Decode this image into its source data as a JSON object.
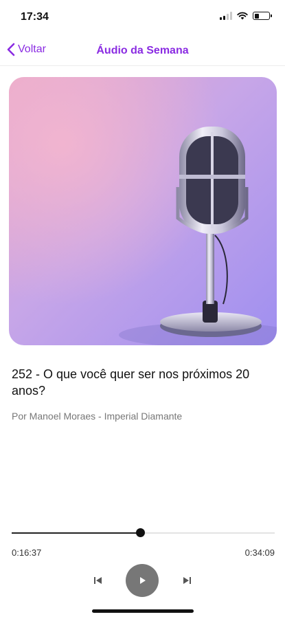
{
  "status_bar": {
    "time": "17:34",
    "battery_level": 0.3
  },
  "nav": {
    "back_label": "Voltar",
    "title": "Áudio da Semana",
    "accent_color": "#8a2be2"
  },
  "cover": {
    "icon": "microphone-illustration"
  },
  "episode": {
    "title": "252 - O que você quer ser nos próximos 20 anos?",
    "author": "Por Manoel Moraes - Imperial Diamante"
  },
  "player": {
    "elapsed": "0:16:37",
    "total": "0:34:09",
    "progress": 0.487,
    "state": "paused"
  }
}
